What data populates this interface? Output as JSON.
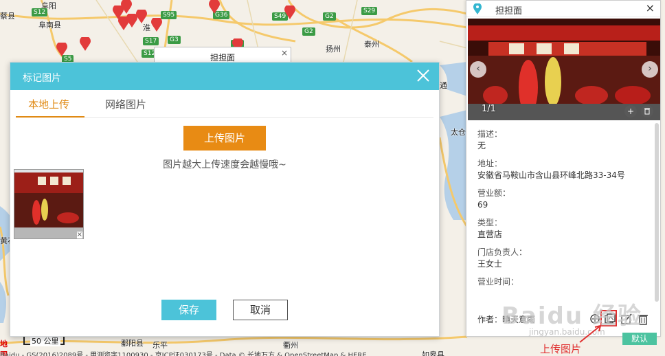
{
  "map": {
    "cities": [
      "阜阳",
      "蔡县",
      "阜南县",
      "淮",
      "扬州",
      "泰州",
      "通",
      "太仓",
      "黄石",
      "鄱阳县",
      "乐平",
      "衢州",
      "如皋县"
    ],
    "shields": [
      "S12",
      "G3",
      "S95",
      "G36",
      "S49",
      "G2",
      "S29",
      "S12",
      "G3",
      "G2",
      "S5",
      "S17"
    ],
    "info_title": "担担面",
    "info_close": "×",
    "scale_logo": "地图",
    "scale_text": "50 公里",
    "copyright": "Baidu - GS(2016)2089号 - 甲测资字1100930 - 京ICP证030173号 - Data © 长地万方 & OpenStreetMap & HERE",
    "pin_color": "#e23b3b",
    "water_color": "#b5d0e8",
    "road_color": "#f5c96b"
  },
  "dialog": {
    "title": "标记图片",
    "close_icon": "close-icon",
    "tabs": [
      {
        "label": "本地上传",
        "active": true
      },
      {
        "label": "网络图片",
        "active": false
      }
    ],
    "upload_label": "上传图片",
    "hint": "图片越大上传速度会越慢哦~",
    "thumb_remove": "×",
    "save_label": "保存",
    "cancel_label": "取消",
    "header_color": "#4cc3d9",
    "accent_color": "#e88b14"
  },
  "panel": {
    "store_name": "担担面",
    "close": "×",
    "photo_count": "1/1",
    "prev": "‹",
    "next": "›",
    "add": "+",
    "delete": "🗑",
    "fields": [
      {
        "label": "描述：",
        "value": "无"
      },
      {
        "label": "地址：",
        "value": "安徽省马鞍山市含山县环峰北路33-34号"
      },
      {
        "label": "营业额：",
        "value": "69"
      },
      {
        "label": "类型：",
        "value": "直营店"
      },
      {
        "label": "门店负责人：",
        "value": "王女士"
      },
      {
        "label": "营业时间：",
        "value": ""
      }
    ],
    "author": "作者：晴天意雨"
  },
  "overlay": {
    "watermark": "Baidu 经验",
    "watermark_url": "jingyan.baidu.com",
    "annotation": "上传图片",
    "default_btn": "默认",
    "annotation_color": "#e03030"
  }
}
